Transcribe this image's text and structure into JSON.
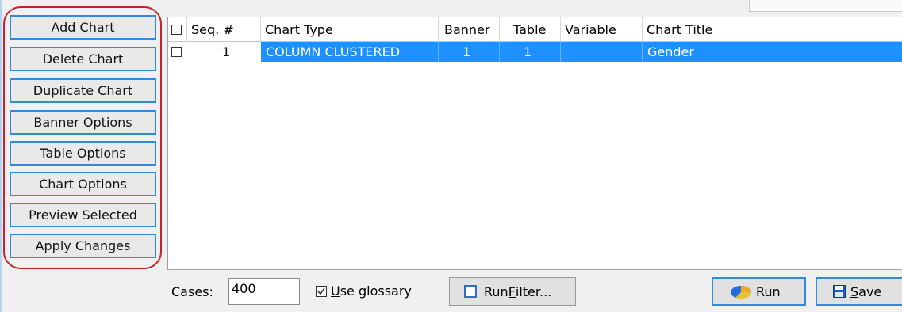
{
  "side_buttons": [
    {
      "label": "Add Chart"
    },
    {
      "label": "Delete Chart"
    },
    {
      "label": "Duplicate Chart"
    },
    {
      "label": "Banner Options"
    },
    {
      "label": "Table Options"
    },
    {
      "label": "Chart Options"
    },
    {
      "label": "Preview Selected"
    },
    {
      "label": "Apply Changes"
    }
  ],
  "grid": {
    "columns": [
      "Seq. #",
      "Chart Type",
      "Banner",
      "Table",
      "Variable",
      "Chart Title"
    ],
    "rows": [
      {
        "checked": false,
        "seq": "1",
        "chart_type": "COLUMN CLUSTERED",
        "banner": "1",
        "table": "1",
        "variable": "",
        "chart_title": "Gender",
        "selected": true
      }
    ]
  },
  "bottom": {
    "cases_label": "Cases:",
    "cases_value": "400",
    "glossary_checked": true,
    "glossary_mnemonic": "U",
    "glossary_rest": "se glossary",
    "run_filter_prefix": "Run ",
    "run_filter_mnemonic": "F",
    "run_filter_rest": "ilter...",
    "run_label": "Run",
    "save_mnemonic": "S",
    "save_rest": "ave"
  },
  "colors": {
    "accent": "#2f8ae0",
    "selection": "#1e90ff",
    "highlight_ring": "#c8202a"
  },
  "icons": {
    "run": "pie-chart-icon",
    "save": "floppy-disk-icon",
    "run_filter": "filter-square-icon"
  }
}
